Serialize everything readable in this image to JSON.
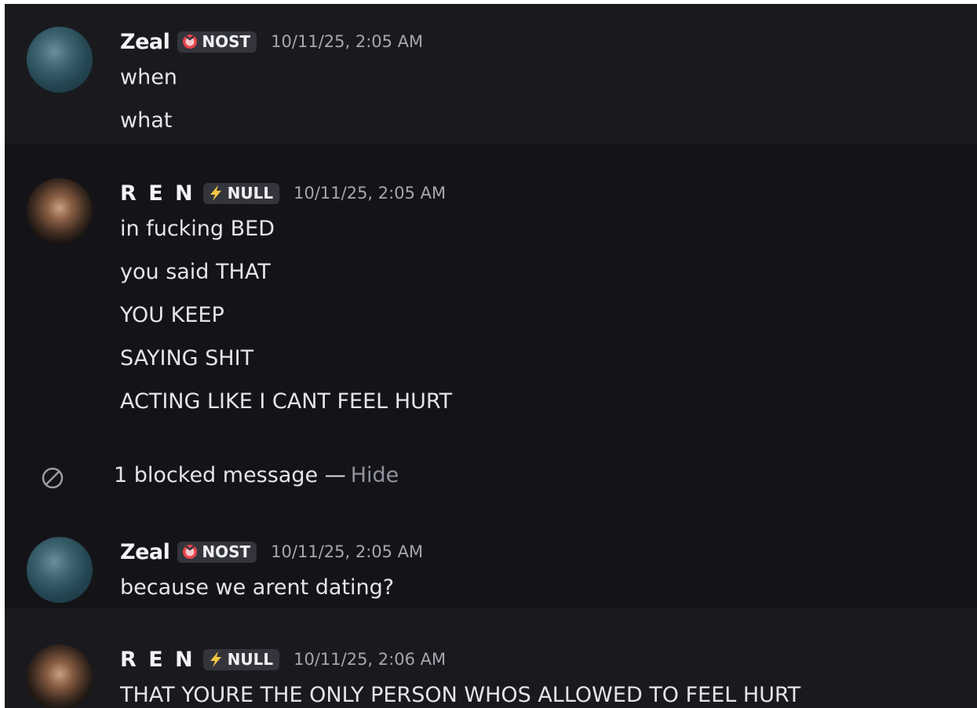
{
  "messages": [
    {
      "username": "Zeal",
      "tag": "NOST",
      "tag_icon": "red-ring-icon",
      "timestamp": "10/11/25, 2:05 AM",
      "lines": [
        "when",
        "what"
      ]
    },
    {
      "username": "R E N",
      "tag": "NULL",
      "tag_icon": "lightning-bolt-icon",
      "timestamp": "10/11/25, 2:05 AM",
      "lines": [
        "in fucking BED",
        "you said THAT",
        "YOU KEEP",
        "SAYING SHIT",
        "ACTING LIKE I CANT FEEL HURT"
      ]
    },
    {
      "username": "Zeal",
      "tag": "NOST",
      "tag_icon": "red-ring-icon",
      "timestamp": "10/11/25, 2:05 AM",
      "lines": [
        "because we arent dating?"
      ]
    },
    {
      "username": "R E N",
      "tag": "NULL",
      "tag_icon": "lightning-bolt-icon",
      "timestamp": "10/11/25, 2:06 AM",
      "lines": [
        "THAT YOURE THE ONLY PERSON WHOS ALLOWED TO FEEL HURT"
      ]
    }
  ],
  "blocked": {
    "icon": "blocked-circle-icon",
    "text": "1 blocked message —",
    "hide_label": "Hide"
  },
  "colors": {
    "background": "#1a1a1e",
    "alt_background": "#141418",
    "nost_icon": "#e8434b",
    "null_icon": "#f5c542"
  }
}
